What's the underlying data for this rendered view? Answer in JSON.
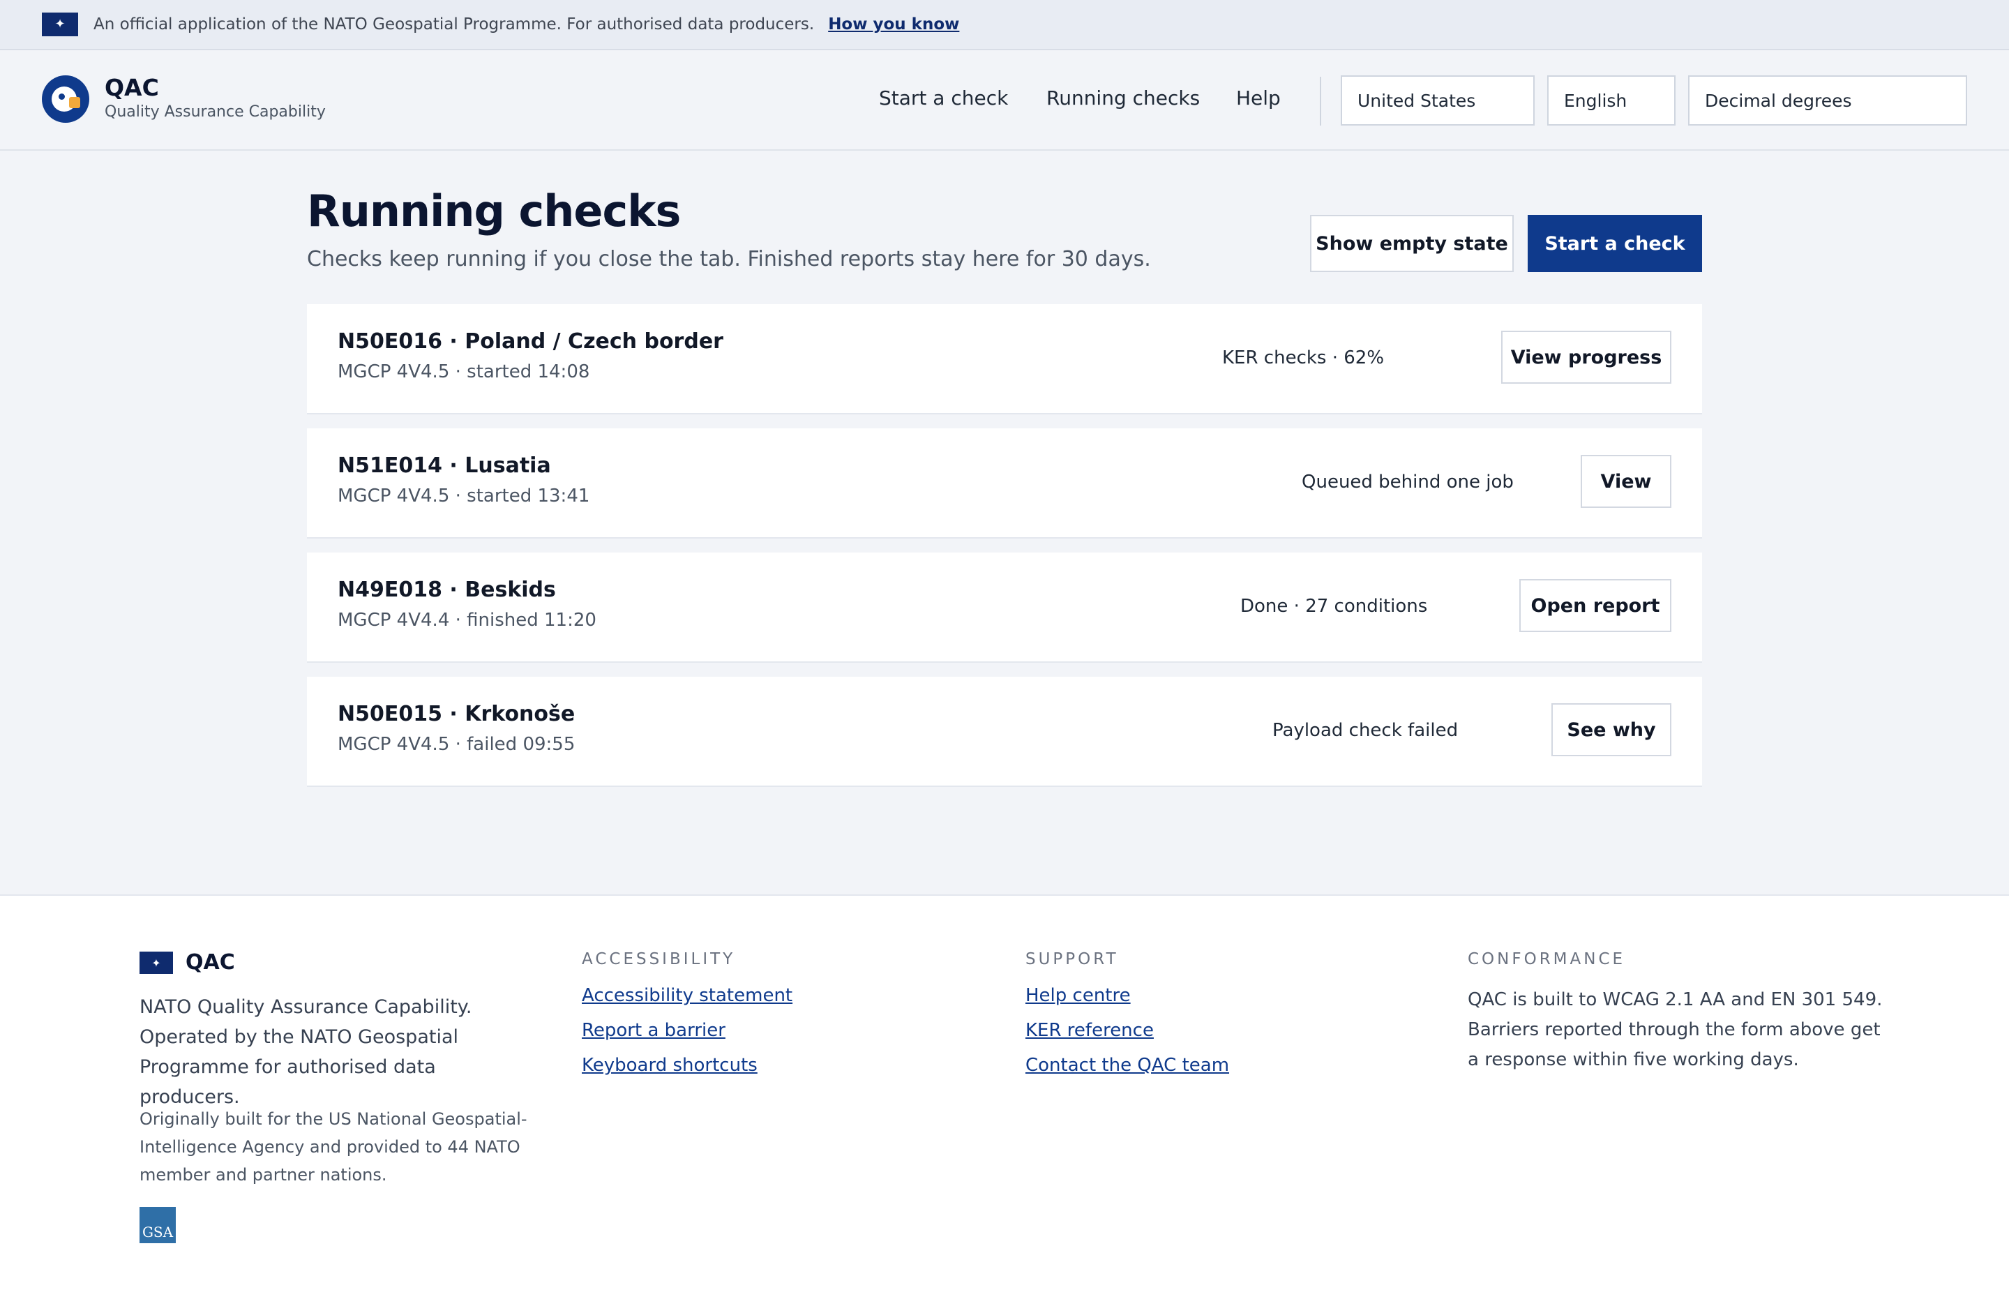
{
  "banner": {
    "text": "An official application of the NATO Geospatial Programme. For authorised data producers.",
    "link": "How you know"
  },
  "header": {
    "title": "QAC",
    "subtitle": "Quality Assurance Capability",
    "nav": [
      "Start a check",
      "Running checks",
      "Help"
    ],
    "country": "United States",
    "language": "English",
    "coordinate_format": "Decimal degrees"
  },
  "main": {
    "title": "Running checks",
    "subtitle": "Checks keep running if you close the tab. Finished reports stay here for 30 days.",
    "show_empty_label": "Show empty state",
    "start_label": "Start a check",
    "checks": [
      {
        "title": "N50E016 · Poland / Czech border",
        "meta": "MGCP 4V4.5 · started 14:08",
        "status": "KER checks · 62%",
        "action": "View progress"
      },
      {
        "title": "N51E014 · Lusatia",
        "meta": "MGCP 4V4.5 · started 13:41",
        "status": "Queued behind one job",
        "action": "View"
      },
      {
        "title": "N49E018 · Beskids",
        "meta": "MGCP 4V4.4 · finished 11:20",
        "status": "Done · 27 conditions",
        "action": "Open report"
      },
      {
        "title": "N50E015 · Krkonoše",
        "meta": "MGCP 4V4.5 · failed 09:55",
        "status": "Payload check failed",
        "action": "See why"
      }
    ]
  },
  "footer": {
    "brand": "QAC",
    "description": "NATO Quality Assurance Capability. Operated by the NATO Geospatial Programme for authorised data producers.",
    "note": "Originally built for the US National Geospatial-Intelligence Agency and provided to 44 NATO member and partner nations.",
    "gsa_logo": "GSA",
    "accessibility": {
      "heading": "ACCESSIBILITY",
      "links": [
        "Accessibility statement",
        "Report a barrier",
        "Keyboard shortcuts"
      ]
    },
    "support": {
      "heading": "SUPPORT",
      "links": [
        "Help centre",
        "KER reference",
        "Contact the QAC team"
      ]
    },
    "conformance": {
      "heading": "CONFORMANCE",
      "text": "QAC is built to WCAG 2.1 AA and EN 301 549. Barriers reported through the form above get a response within five working days."
    }
  }
}
